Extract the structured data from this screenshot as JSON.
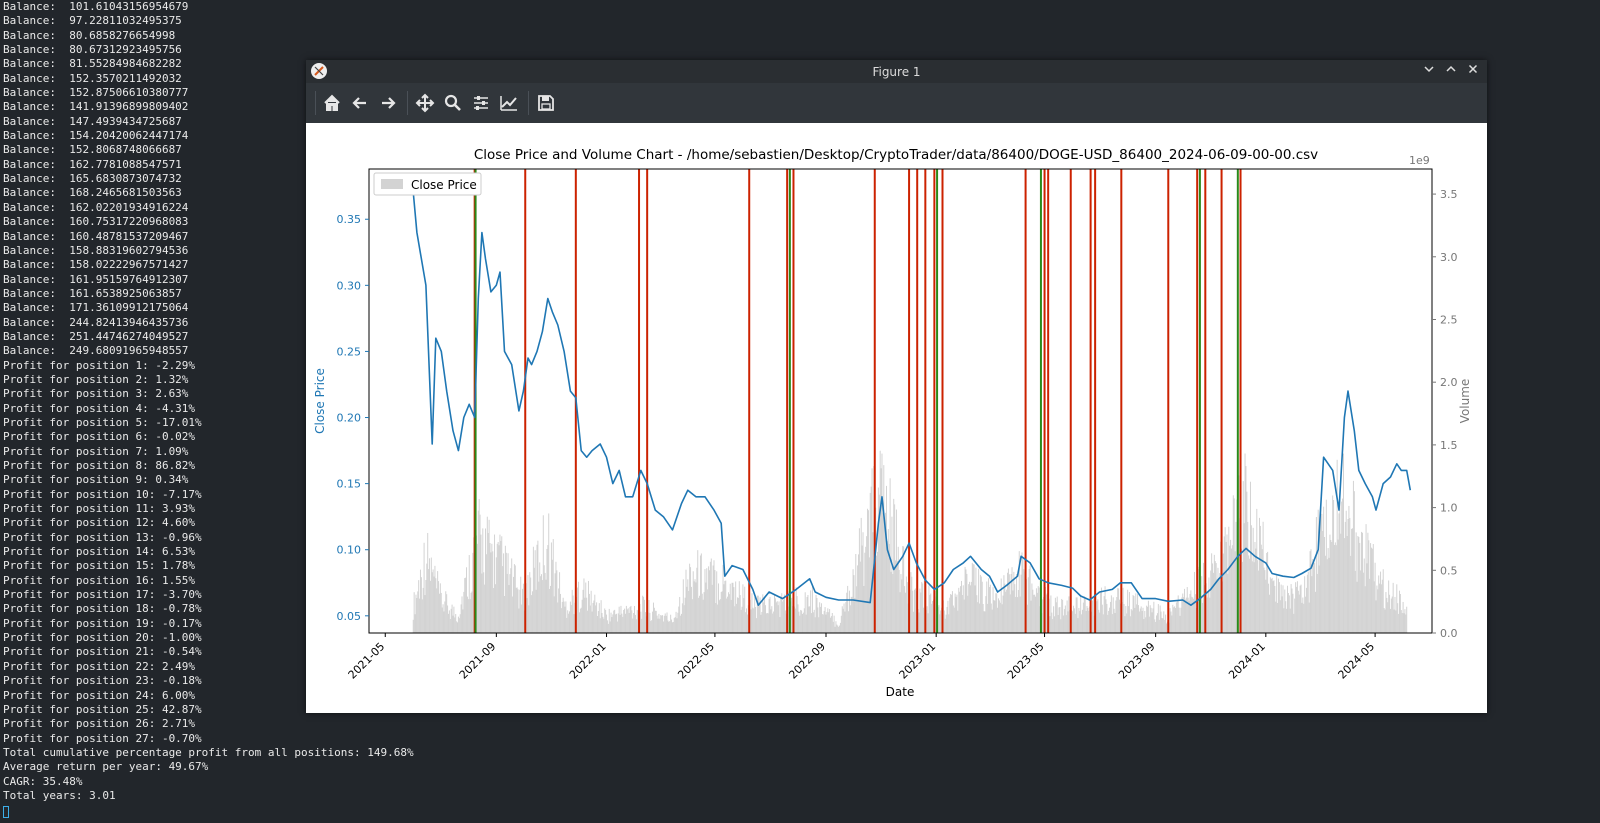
{
  "terminal": {
    "lines": [
      "Balance:  101.61043156954679",
      "Balance:  97.22811032495375",
      "Balance:  80.6858276654998",
      "Balance:  80.67312923495756",
      "Balance:  81.55284984682282",
      "Balance:  152.3570211492032",
      "Balance:  152.87506610380777",
      "Balance:  141.91396899809402",
      "Balance:  147.4939434725687",
      "Balance:  154.20420062447174",
      "Balance:  152.8068748066687",
      "Balance:  162.7781088547571",
      "Balance:  165.6830873074732",
      "Balance:  168.2465681503563",
      "Balance:  162.02201934916224",
      "Balance:  160.75317220968083",
      "Balance:  160.48781537209467",
      "Balance:  158.88319602794536",
      "Balance:  158.02222967571427",
      "Balance:  161.95159764912307",
      "Balance:  161.6538925063857",
      "Balance:  171.36109912175064",
      "Balance:  244.82413946435736",
      "Balance:  251.44746274049527",
      "Balance:  249.68091965948557",
      "Profit for position 1: -2.29%",
      "Profit for position 2: 1.32%",
      "Profit for position 3: 2.63%",
      "Profit for position 4: -4.31%",
      "Profit for position 5: -17.01%",
      "Profit for position 6: -0.02%",
      "Profit for position 7: 1.09%",
      "Profit for position 8: 86.82%",
      "Profit for position 9: 0.34%",
      "Profit for position 10: -7.17%",
      "Profit for position 11: 3.93%",
      "Profit for position 12: 4.60%",
      "Profit for position 13: -0.96%",
      "Profit for position 14: 6.53%",
      "Profit for position 15: 1.78%",
      "Profit for position 16: 1.55%",
      "Profit for position 17: -3.70%",
      "Profit for position 18: -0.78%",
      "Profit for position 19: -0.17%",
      "Profit for position 20: -1.00%",
      "Profit for position 21: -0.54%",
      "Profit for position 22: 2.49%",
      "Profit for position 23: -0.18%",
      "Profit for position 24: 6.00%",
      "Profit for position 25: 42.87%",
      "Profit for position 26: 2.71%",
      "Profit for position 27: -0.70%",
      "Total cumulative percentage profit from all positions: 149.68%",
      "Average return per year: 49.67%",
      "CAGR: 35.48%",
      "Total years: 3.01"
    ]
  },
  "window": {
    "title": "Figure 1",
    "controls": [
      "minimize",
      "maximize",
      "close"
    ]
  },
  "toolbar": {
    "tools": [
      {
        "name": "home-button",
        "icon": "home-icon",
        "label": "Home"
      },
      {
        "name": "back-button",
        "icon": "arrow-left-icon",
        "label": "Back"
      },
      {
        "name": "forward-button",
        "icon": "arrow-right-icon",
        "label": "Forward"
      },
      {
        "name": "pan-button",
        "icon": "move-icon",
        "label": "Pan"
      },
      {
        "name": "zoom-button",
        "icon": "magnifier-icon",
        "label": "Zoom"
      },
      {
        "name": "configure-subplots-button",
        "icon": "sliders-icon",
        "label": "Subplots"
      },
      {
        "name": "edit-axes-button",
        "icon": "line-chart-icon",
        "label": "Customize"
      },
      {
        "name": "save-button",
        "icon": "floppy-disk-icon",
        "label": "Save"
      }
    ]
  },
  "chart_data": {
    "type": "line",
    "title": "Close Price and Volume Chart - /home/sebastien/Desktop/CryptoTrader/data/86400/DOGE-USD_86400_2024-06-09-00-00.csv",
    "xlabel": "Date",
    "ylabel": "Close Price",
    "y2label": "Volume",
    "y2_offset_text": "1e9",
    "xlim": [
      "2021-04-13",
      "2024-07-03"
    ],
    "ylim": [
      0.037,
      0.388
    ],
    "y2lim": [
      0,
      3.7
    ],
    "x_ticks": [
      "2021-05",
      "2021-09",
      "2022-01",
      "2022-05",
      "2022-09",
      "2023-01",
      "2023-05",
      "2023-09",
      "2024-01",
      "2024-05"
    ],
    "y_ticks": [
      "0.05",
      "0.10",
      "0.15",
      "0.20",
      "0.25",
      "0.30",
      "0.35"
    ],
    "y2_ticks": [
      "0.0",
      "0.5",
      "1.0",
      "1.5",
      "2.0",
      "2.5",
      "3.0",
      "3.5"
    ],
    "legend": {
      "entries": [
        "Close Price"
      ],
      "placement": "upper-left"
    },
    "colors": {
      "price": "#1f77b4",
      "volume": "#d3d3d3",
      "sell": "#cc2200",
      "buy": "#2a8a1a",
      "left_axis": "#1f77b4",
      "right_axis": "#777777"
    },
    "series": [
      {
        "name": "Close Price",
        "points": [
          [
            "2021-06-01",
            0.37
          ],
          [
            "2021-06-05",
            0.34
          ],
          [
            "2021-06-10",
            0.32
          ],
          [
            "2021-06-15",
            0.3
          ],
          [
            "2021-06-22",
            0.18
          ],
          [
            "2021-06-26",
            0.26
          ],
          [
            "2021-07-02",
            0.25
          ],
          [
            "2021-07-08",
            0.22
          ],
          [
            "2021-07-15",
            0.19
          ],
          [
            "2021-07-21",
            0.175
          ],
          [
            "2021-07-27",
            0.2
          ],
          [
            "2021-08-02",
            0.21
          ],
          [
            "2021-08-08",
            0.2
          ],
          [
            "2021-08-12",
            0.29
          ],
          [
            "2021-08-16",
            0.34
          ],
          [
            "2021-08-20",
            0.32
          ],
          [
            "2021-08-26",
            0.295
          ],
          [
            "2021-09-01",
            0.3
          ],
          [
            "2021-09-05",
            0.31
          ],
          [
            "2021-09-10",
            0.25
          ],
          [
            "2021-09-18",
            0.24
          ],
          [
            "2021-09-26",
            0.205
          ],
          [
            "2021-10-01",
            0.22
          ],
          [
            "2021-10-06",
            0.245
          ],
          [
            "2021-10-10",
            0.24
          ],
          [
            "2021-10-16",
            0.25
          ],
          [
            "2021-10-22",
            0.265
          ],
          [
            "2021-10-28",
            0.29
          ],
          [
            "2021-11-02",
            0.28
          ],
          [
            "2021-11-08",
            0.27
          ],
          [
            "2021-11-15",
            0.25
          ],
          [
            "2021-11-22",
            0.22
          ],
          [
            "2021-11-28",
            0.215
          ],
          [
            "2021-12-04",
            0.175
          ],
          [
            "2021-12-10",
            0.17
          ],
          [
            "2021-12-16",
            0.175
          ],
          [
            "2021-12-25",
            0.18
          ],
          [
            "2022-01-01",
            0.17
          ],
          [
            "2022-01-08",
            0.15
          ],
          [
            "2022-01-15",
            0.16
          ],
          [
            "2022-01-22",
            0.14
          ],
          [
            "2022-01-30",
            0.14
          ],
          [
            "2022-02-08",
            0.16
          ],
          [
            "2022-02-15",
            0.15
          ],
          [
            "2022-02-24",
            0.13
          ],
          [
            "2022-03-05",
            0.125
          ],
          [
            "2022-03-15",
            0.115
          ],
          [
            "2022-03-25",
            0.135
          ],
          [
            "2022-04-01",
            0.145
          ],
          [
            "2022-04-10",
            0.14
          ],
          [
            "2022-04-20",
            0.14
          ],
          [
            "2022-04-30",
            0.13
          ],
          [
            "2022-05-08",
            0.12
          ],
          [
            "2022-05-12",
            0.08
          ],
          [
            "2022-05-20",
            0.088
          ],
          [
            "2022-06-01",
            0.085
          ],
          [
            "2022-06-12",
            0.07
          ],
          [
            "2022-06-18",
            0.058
          ],
          [
            "2022-06-30",
            0.068
          ],
          [
            "2022-07-15",
            0.063
          ],
          [
            "2022-07-30",
            0.07
          ],
          [
            "2022-08-14",
            0.078
          ],
          [
            "2022-08-20",
            0.068
          ],
          [
            "2022-09-01",
            0.064
          ],
          [
            "2022-09-15",
            0.062
          ],
          [
            "2022-10-01",
            0.062
          ],
          [
            "2022-10-20",
            0.06
          ],
          [
            "2022-10-29",
            0.12
          ],
          [
            "2022-11-02",
            0.14
          ],
          [
            "2022-11-08",
            0.1
          ],
          [
            "2022-11-15",
            0.085
          ],
          [
            "2022-11-25",
            0.095
          ],
          [
            "2022-12-02",
            0.105
          ],
          [
            "2022-12-10",
            0.09
          ],
          [
            "2022-12-20",
            0.077
          ],
          [
            "2022-12-30",
            0.07
          ],
          [
            "2023-01-10",
            0.075
          ],
          [
            "2023-01-20",
            0.085
          ],
          [
            "2023-01-31",
            0.09
          ],
          [
            "2023-02-08",
            0.095
          ],
          [
            "2023-02-20",
            0.085
          ],
          [
            "2023-03-01",
            0.08
          ],
          [
            "2023-03-10",
            0.068
          ],
          [
            "2023-03-20",
            0.073
          ],
          [
            "2023-04-01",
            0.08
          ],
          [
            "2023-04-05",
            0.095
          ],
          [
            "2023-04-15",
            0.09
          ],
          [
            "2023-04-25",
            0.078
          ],
          [
            "2023-05-05",
            0.075
          ],
          [
            "2023-05-20",
            0.073
          ],
          [
            "2023-06-01",
            0.071
          ],
          [
            "2023-06-10",
            0.065
          ],
          [
            "2023-06-20",
            0.062
          ],
          [
            "2023-07-01",
            0.068
          ],
          [
            "2023-07-15",
            0.07
          ],
          [
            "2023-07-24",
            0.075
          ],
          [
            "2023-08-05",
            0.075
          ],
          [
            "2023-08-17",
            0.063
          ],
          [
            "2023-09-01",
            0.063
          ],
          [
            "2023-09-15",
            0.061
          ],
          [
            "2023-10-01",
            0.062
          ],
          [
            "2023-10-10",
            0.058
          ],
          [
            "2023-10-20",
            0.063
          ],
          [
            "2023-11-01",
            0.07
          ],
          [
            "2023-11-10",
            0.078
          ],
          [
            "2023-11-20",
            0.085
          ],
          [
            "2023-12-01",
            0.095
          ],
          [
            "2023-12-10",
            0.101
          ],
          [
            "2023-12-20",
            0.095
          ],
          [
            "2024-01-01",
            0.09
          ],
          [
            "2024-01-08",
            0.082
          ],
          [
            "2024-01-20",
            0.08
          ],
          [
            "2024-02-01",
            0.079
          ],
          [
            "2024-02-10",
            0.082
          ],
          [
            "2024-02-20",
            0.086
          ],
          [
            "2024-02-28",
            0.1
          ],
          [
            "2024-03-05",
            0.17
          ],
          [
            "2024-03-15",
            0.16
          ],
          [
            "2024-03-22",
            0.13
          ],
          [
            "2024-03-28",
            0.2
          ],
          [
            "2024-04-01",
            0.22
          ],
          [
            "2024-04-08",
            0.19
          ],
          [
            "2024-04-13",
            0.16
          ],
          [
            "2024-04-20",
            0.15
          ],
          [
            "2024-04-28",
            0.14
          ],
          [
            "2024-05-02",
            0.13
          ],
          [
            "2024-05-10",
            0.15
          ],
          [
            "2024-05-18",
            0.155
          ],
          [
            "2024-05-25",
            0.165
          ],
          [
            "2024-05-30",
            0.16
          ],
          [
            "2024-06-05",
            0.16
          ],
          [
            "2024-06-09",
            0.145
          ]
        ]
      },
      {
        "name": "Volume",
        "points": [
          [
            "2021-06-01",
            0.3
          ],
          [
            "2021-06-15",
            0.9
          ],
          [
            "2021-07-01",
            0.4
          ],
          [
            "2021-07-20",
            0.2
          ],
          [
            "2021-08-12",
            1.1
          ],
          [
            "2021-09-07",
            0.8
          ],
          [
            "2021-10-01",
            0.4
          ],
          [
            "2021-10-27",
            1.1
          ],
          [
            "2021-11-15",
            0.3
          ],
          [
            "2021-12-05",
            0.5
          ],
          [
            "2022-01-01",
            0.2
          ],
          [
            "2022-02-10",
            0.3
          ],
          [
            "2022-03-15",
            0.15
          ],
          [
            "2022-04-05",
            0.7
          ],
          [
            "2022-05-12",
            0.6
          ],
          [
            "2022-06-15",
            0.3
          ],
          [
            "2022-08-15",
            0.4
          ],
          [
            "2022-09-15",
            0.1
          ],
          [
            "2022-10-30",
            1.6
          ],
          [
            "2022-11-10",
            1.3
          ],
          [
            "2022-12-01",
            0.5
          ],
          [
            "2023-01-15",
            0.3
          ],
          [
            "2023-02-05",
            0.6
          ],
          [
            "2023-03-10",
            0.4
          ],
          [
            "2023-04-05",
            0.7
          ],
          [
            "2023-05-10",
            0.3
          ],
          [
            "2023-06-10",
            0.3
          ],
          [
            "2023-07-15",
            0.4
          ],
          [
            "2023-08-17",
            0.3
          ],
          [
            "2023-09-15",
            0.2
          ],
          [
            "2023-10-25",
            0.6
          ],
          [
            "2023-11-15",
            0.8
          ],
          [
            "2023-12-10",
            1.5
          ],
          [
            "2024-01-10",
            0.5
          ],
          [
            "2024-02-10",
            0.4
          ],
          [
            "2024-03-01",
            1.1
          ],
          [
            "2024-03-30",
            1.6
          ],
          [
            "2024-04-15",
            1.0
          ],
          [
            "2024-05-05",
            0.6
          ],
          [
            "2024-06-05",
            0.3
          ]
        ]
      }
    ],
    "trade_markers": [
      {
        "date": "2021-08-08",
        "type": "sell"
      },
      {
        "date": "2021-08-09",
        "type": "buy"
      },
      {
        "date": "2021-10-03",
        "type": "sell"
      },
      {
        "date": "2021-11-28",
        "type": "sell"
      },
      {
        "date": "2022-02-06",
        "type": "sell"
      },
      {
        "date": "2022-02-15",
        "type": "sell"
      },
      {
        "date": "2022-06-08",
        "type": "sell"
      },
      {
        "date": "2022-07-20",
        "type": "sell"
      },
      {
        "date": "2022-07-23",
        "type": "buy"
      },
      {
        "date": "2022-07-27",
        "type": "sell"
      },
      {
        "date": "2022-10-25",
        "type": "sell"
      },
      {
        "date": "2022-12-02",
        "type": "sell"
      },
      {
        "date": "2022-12-11",
        "type": "sell"
      },
      {
        "date": "2022-12-20",
        "type": "sell"
      },
      {
        "date": "2022-12-30",
        "type": "sell"
      },
      {
        "date": "2023-01-02",
        "type": "buy"
      },
      {
        "date": "2023-01-08",
        "type": "sell"
      },
      {
        "date": "2023-04-10",
        "type": "sell"
      },
      {
        "date": "2023-04-27",
        "type": "buy"
      },
      {
        "date": "2023-05-01",
        "type": "sell"
      },
      {
        "date": "2023-05-05",
        "type": "sell"
      },
      {
        "date": "2023-05-30",
        "type": "sell"
      },
      {
        "date": "2023-06-21",
        "type": "sell"
      },
      {
        "date": "2023-06-26",
        "type": "sell"
      },
      {
        "date": "2023-07-25",
        "type": "sell"
      },
      {
        "date": "2023-09-15",
        "type": "sell"
      },
      {
        "date": "2023-10-17",
        "type": "sell"
      },
      {
        "date": "2023-10-20",
        "type": "buy"
      },
      {
        "date": "2023-10-26",
        "type": "sell"
      },
      {
        "date": "2023-11-13",
        "type": "sell"
      },
      {
        "date": "2023-12-01",
        "type": "buy"
      },
      {
        "date": "2023-12-04",
        "type": "sell"
      }
    ]
  }
}
